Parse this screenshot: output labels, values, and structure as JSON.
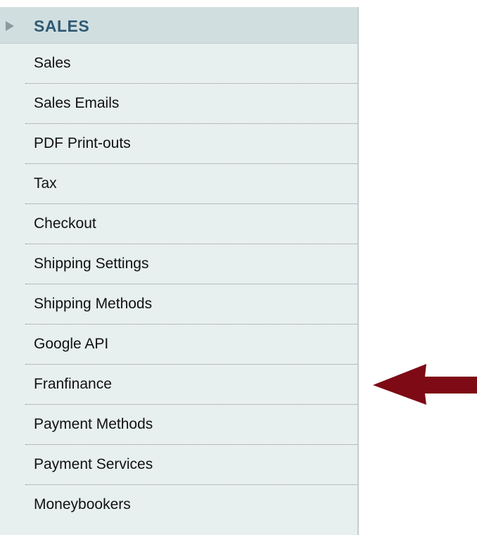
{
  "sidebar": {
    "section_title": "SALES",
    "items": [
      {
        "label": "Sales"
      },
      {
        "label": "Sales Emails"
      },
      {
        "label": "PDF Print-outs"
      },
      {
        "label": "Tax"
      },
      {
        "label": "Checkout"
      },
      {
        "label": "Shipping Settings"
      },
      {
        "label": "Shipping Methods"
      },
      {
        "label": "Google API"
      },
      {
        "label": "Franfinance"
      },
      {
        "label": "Payment Methods"
      },
      {
        "label": "Payment Services"
      },
      {
        "label": "Moneybookers"
      }
    ]
  },
  "annotation": {
    "icon": "left-arrow-icon",
    "color": "#7d0a15",
    "points_to": "Franfinance"
  },
  "colors": {
    "header_text": "#2f5a75",
    "header_bg": "#d1dedf",
    "sidebar_bg": "#e7efef"
  }
}
